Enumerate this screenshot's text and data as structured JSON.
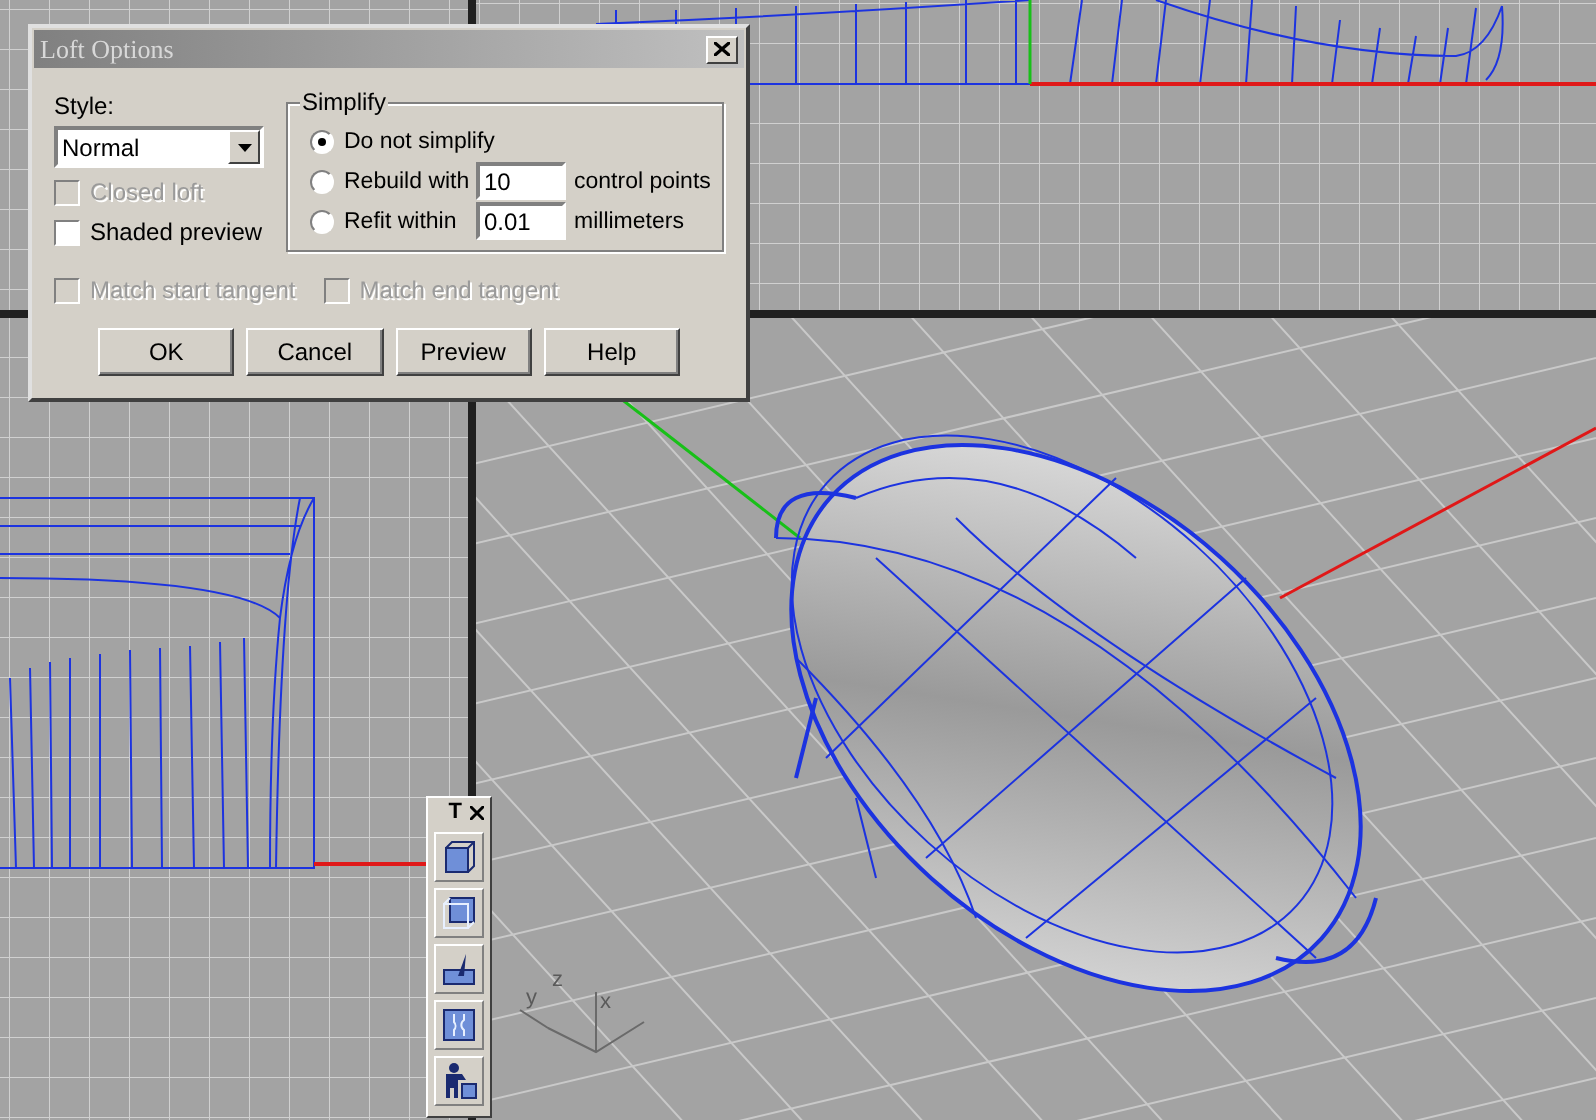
{
  "dialog": {
    "title": "Loft Options",
    "style": {
      "label": "Style:",
      "value": "Normal"
    },
    "options": [
      {
        "label": "Closed loft",
        "checked": false,
        "disabled": true
      },
      {
        "label": "Shaded preview",
        "checked": false,
        "disabled": false
      }
    ],
    "simplify": {
      "title": "Simplify",
      "choices": [
        {
          "label": "Do not simplify",
          "selected": true
        },
        {
          "label": "Rebuild with",
          "selected": false,
          "value": "10",
          "unit": "control points"
        },
        {
          "label": "Refit within",
          "selected": false,
          "value": "0.01",
          "unit": "millimeters"
        }
      ]
    },
    "tangents": [
      {
        "label": "Match start tangent",
        "checked": false,
        "disabled": true
      },
      {
        "label": "Match end tangent",
        "checked": false,
        "disabled": true
      }
    ],
    "buttons": [
      "OK",
      "Cancel",
      "Preview",
      "Help"
    ]
  },
  "toolbar": {
    "title": "T"
  },
  "axis_labels": [
    "y",
    "z",
    "x"
  ]
}
